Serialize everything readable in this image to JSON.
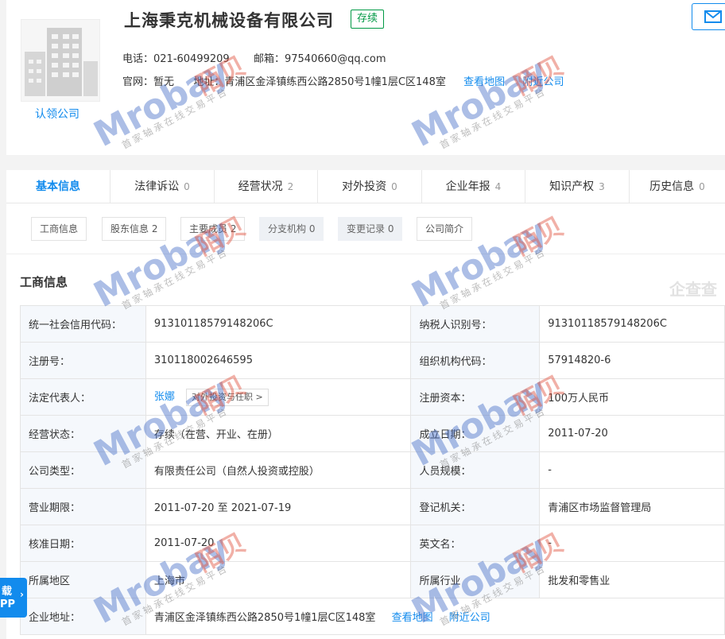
{
  "company": {
    "name": "上海秉克机械设备有限公司",
    "status": "存续",
    "claim": "认领公司",
    "phone_label": "电话：",
    "phone": "021-60499209",
    "email_label": "邮箱：",
    "email": "97540660@qq.com",
    "website_label": "官网：",
    "website": "暂无",
    "address_label": "地址：",
    "address": "青浦区金泽镇练西公路2850号1幢1层C区148室",
    "map_link": "查看地图",
    "nearby_link": "附近公司"
  },
  "tabs": [
    {
      "label": "基本信息",
      "count": ""
    },
    {
      "label": "法律诉讼",
      "count": "0"
    },
    {
      "label": "经营状况",
      "count": "2"
    },
    {
      "label": "对外投资",
      "count": "0"
    },
    {
      "label": "企业年报",
      "count": "4"
    },
    {
      "label": "知识产权",
      "count": "3"
    },
    {
      "label": "历史信息",
      "count": "0"
    }
  ],
  "subtabs": [
    {
      "label": "工商信息"
    },
    {
      "label": "股东信息 2"
    },
    {
      "label": "主要成员 2"
    },
    {
      "label": "分支机构 0"
    },
    {
      "label": "变更记录 0"
    },
    {
      "label": "公司简介"
    }
  ],
  "section_title": "工商信息",
  "qcc_watermark": "企查查",
  "rows": [
    {
      "k1": "统一社会信用代码：",
      "v1": "91310118579148206C",
      "k2": "纳税人识别号：",
      "v2": "91310118579148206C"
    },
    {
      "k1": "注册号：",
      "v1": "310118002646595",
      "k2": "组织机构代码：",
      "v2": "57914820-6"
    },
    {
      "k1": "法定代表人：",
      "v1": "张娜",
      "tag": "对外投资与任职 >",
      "k2": "注册资本：",
      "v2": "100万人民币"
    },
    {
      "k1": "经营状态：",
      "v1": "存续（在营、开业、在册）",
      "k2": "成立日期：",
      "v2": "2011-07-20"
    },
    {
      "k1": "公司类型：",
      "v1": "有限责任公司（自然人投资或控股）",
      "k2": "人员规模：",
      "v2": "-"
    },
    {
      "k1": "营业期限：",
      "v1": "2011-07-20 至 2021-07-19",
      "k2": "登记机关：",
      "v2": "青浦区市场监督管理局"
    },
    {
      "k1": "核准日期：",
      "v1": "2011-07-20",
      "k2": "英文名：",
      "v2": "-"
    },
    {
      "k1": "所属地区",
      "v1": "上海市",
      "k2": "所属行业",
      "v2": "批发和零售业"
    },
    {
      "k1": "企业地址：",
      "v1": "青浦区金泽镇练西公路2850号1幢1层C区148室",
      "map": "查看地图",
      "nearby": "附近公司"
    }
  ],
  "download": {
    "line1": "载",
    "line2": "PP"
  },
  "watermark": {
    "brand": "Mrobay",
    "brand_cn": "陌贝",
    "slogan": "首家轴承在线交易平台"
  },
  "colors": {
    "accent": "#128bed",
    "status_green": "#009944"
  }
}
